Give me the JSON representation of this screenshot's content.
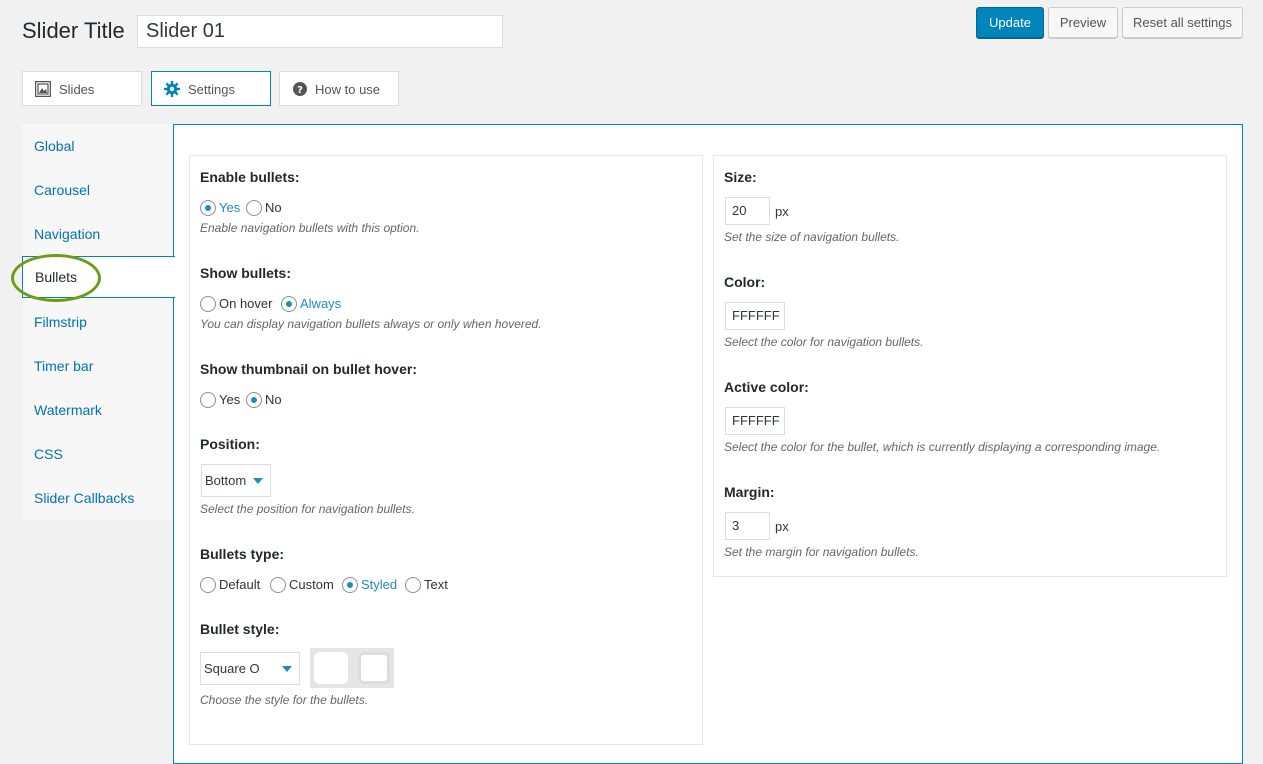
{
  "header": {
    "title_label": "Slider Title",
    "title_value": "Slider 01",
    "update_label": "Update",
    "preview_label": "Preview",
    "reset_label": "Reset all settings"
  },
  "tabs": [
    {
      "label": "Slides",
      "icon": "gallery-icon"
    },
    {
      "label": "Settings",
      "icon": "gear-icon",
      "active": true
    },
    {
      "label": "How to use",
      "icon": "help-icon"
    }
  ],
  "sidebar": {
    "items": [
      {
        "label": "Global"
      },
      {
        "label": "Carousel"
      },
      {
        "label": "Navigation"
      },
      {
        "label": "Bullets",
        "active": true
      },
      {
        "label": "Filmstrip"
      },
      {
        "label": "Timer bar"
      },
      {
        "label": "Watermark"
      },
      {
        "label": "CSS"
      },
      {
        "label": "Slider Callbacks"
      }
    ]
  },
  "left": {
    "enable": {
      "label": "Enable bullets:",
      "opt1": "Yes",
      "opt2": "No",
      "selected": "Yes",
      "desc": "Enable navigation bullets with this option."
    },
    "show": {
      "label": "Show bullets:",
      "opt1": "On hover",
      "opt2": "Always",
      "selected": "Always",
      "desc": "You can display navigation bullets always or only when hovered."
    },
    "thumb": {
      "label": "Show thumbnail on bullet hover:",
      "opt1": "Yes",
      "opt2": "No",
      "selected": "No"
    },
    "position": {
      "label": "Position:",
      "value": "Bottom",
      "desc": "Select the position for navigation bullets."
    },
    "type": {
      "label": "Bullets type:",
      "opt1": "Default",
      "opt2": "Custom",
      "opt3": "Styled",
      "opt4": "Text",
      "selected": "Styled"
    },
    "style": {
      "label": "Bullet style:",
      "value": "Square O",
      "desc": "Choose the style for the bullets."
    }
  },
  "right": {
    "size": {
      "label": "Size:",
      "value": "20",
      "unit": "px",
      "desc": "Set the size of navigation bullets."
    },
    "color": {
      "label": "Color:",
      "value": "FFFFFF",
      "desc": "Select the color for navigation bullets."
    },
    "active_color": {
      "label": "Active color:",
      "value": "FFFFFF",
      "desc": "Select the color for the bullet, which is currently displaying a corresponding image."
    },
    "margin": {
      "label": "Margin:",
      "value": "3",
      "unit": "px",
      "desc": "Set the margin for navigation bullets."
    }
  },
  "colors": {
    "accent": "#0085ba",
    "link": "#0073aa",
    "radio": "#1e8cbe",
    "annotation": "#6f9b16"
  }
}
